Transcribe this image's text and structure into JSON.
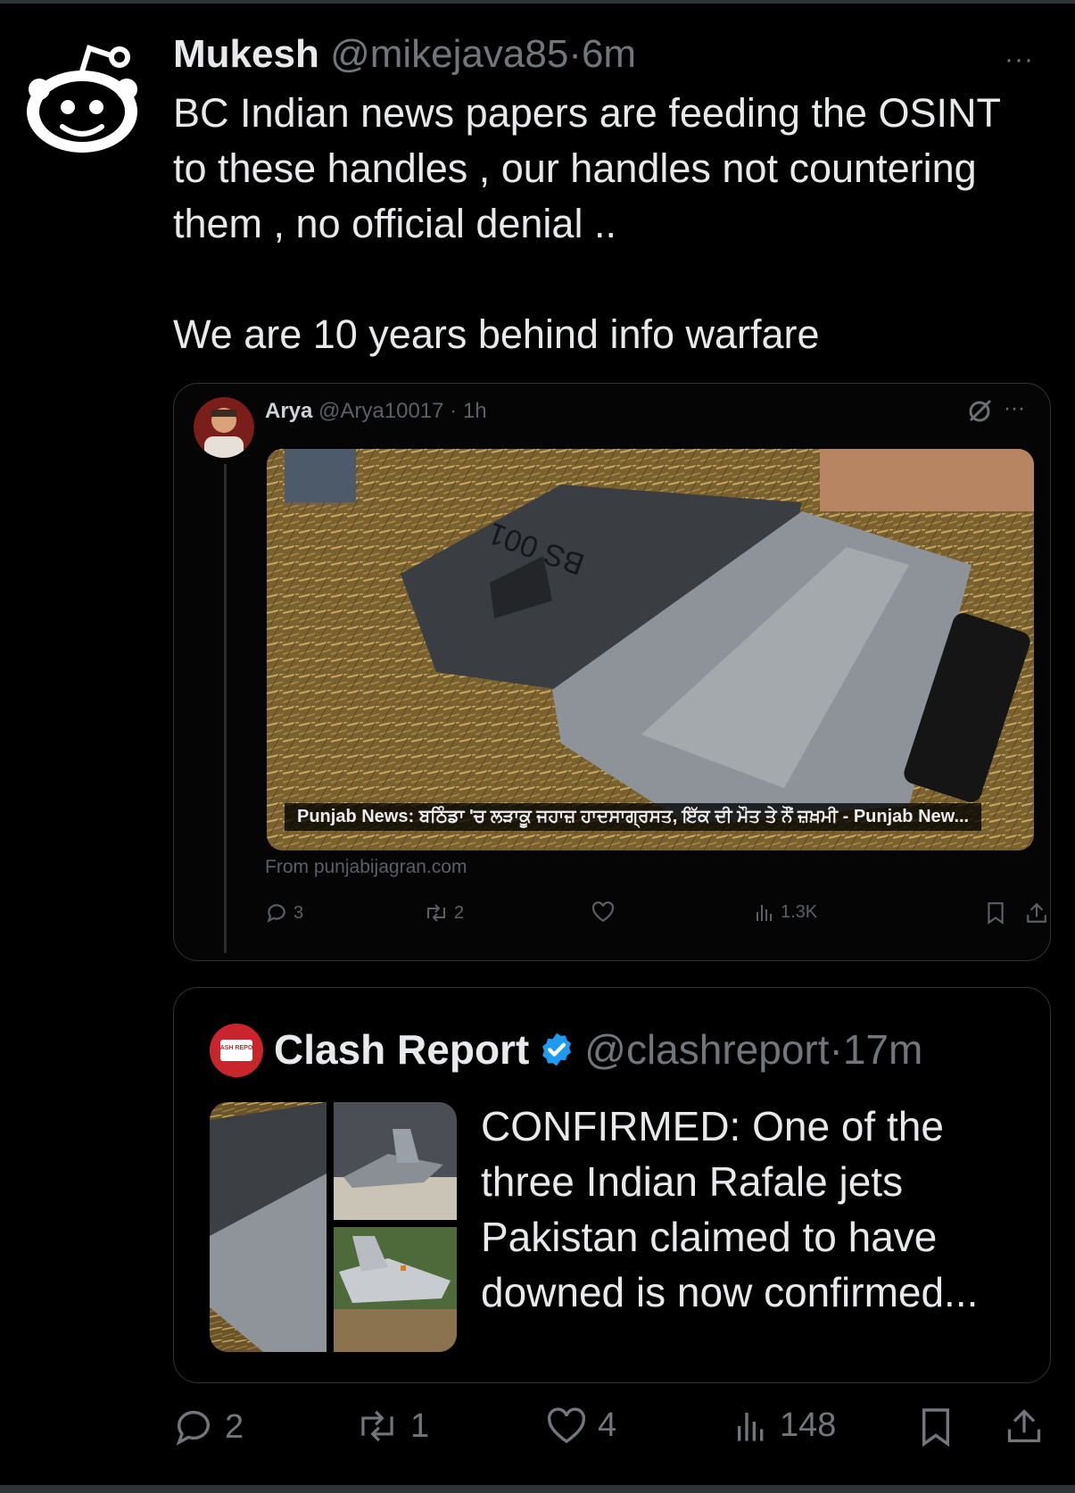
{
  "post": {
    "name": "Mukesh",
    "handle": "@mikejava85",
    "dot": "·",
    "time": "6m",
    "more": "···",
    "text_lines": [
      "BC Indian news papers are feeding the OSINT",
      "to these handles , our handles not countering",
      "them , no official denial .."
    ],
    "text_line2": "We are 10 years behind info warfare",
    "actions": {
      "replies": "2",
      "reposts": "1",
      "likes": "4",
      "views": "148"
    }
  },
  "quote1": {
    "name": "Arya",
    "handle": "@Arya10017",
    "dot": "·",
    "time": "1h",
    "more": "···",
    "caption": "Punjab News: ਬਠਿੰਡਾ 'ਚ ਲੜਾਕੂ ਜਹਾਜ਼ ਹਾਦਸਾਗ੍ਰਸਤ, ਇੱਕ ਦੀ ਮੌਤ ਤੇ ਨੌਂ ਜ਼ਖ਼ਮੀ - Punjab New...",
    "panel_text": "BS 001",
    "from": "From punjabijagran.com",
    "actions": {
      "replies": "3",
      "reposts": "2",
      "views": "1.3K"
    }
  },
  "quote2": {
    "logo_text": "CLASH REPORT",
    "name": "Clash Report",
    "handle": "@clashreport",
    "dot": "·",
    "time": "17m",
    "text": "CONFIRMED: One of the three Indian Rafale jets Pakistan claimed to have downed is now confirmed..."
  },
  "colors": {
    "background": "#000000",
    "text": "#e7e9ea",
    "muted": "#71767b",
    "border": "#2f3336",
    "verified": "#1d9bf0",
    "brand_red": "#c9252c"
  },
  "icons": [
    "reply-icon",
    "repost-icon",
    "like-icon",
    "views-icon",
    "bookmark-icon",
    "share-icon",
    "verified-badge-icon",
    "grok-icon",
    "more-icon"
  ]
}
